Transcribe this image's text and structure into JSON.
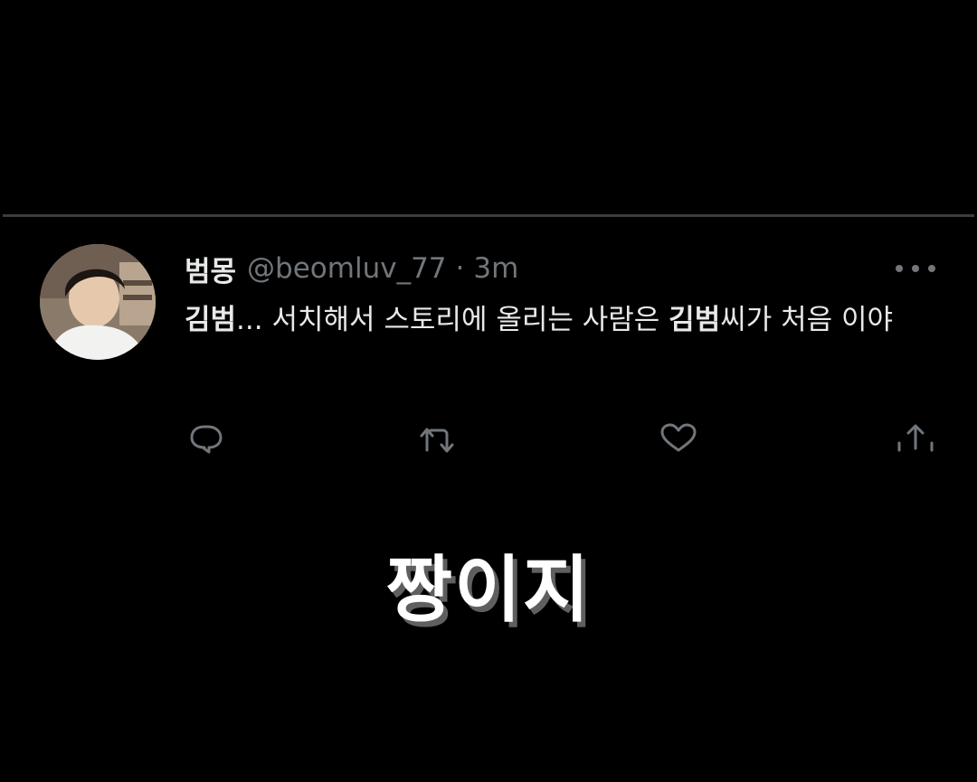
{
  "tweet": {
    "display_name": "범몽",
    "handle": "@beomluv_77",
    "separator": "·",
    "time": "3m",
    "body": {
      "part1_bold": "김범",
      "part2": "... 서치해서 스토리에 올리는 사람은 ",
      "part3_bold": "김범",
      "part4": "씨가 처음 이야"
    },
    "more_icon": "more-dots-icon",
    "actions": [
      "reply-icon",
      "retweet-icon",
      "like-icon",
      "share-icon"
    ]
  },
  "caption": "짱이지",
  "colors": {
    "background": "#000000",
    "text": "#e7e9ea",
    "secondary": "#71767b",
    "divider": "#3a3d40"
  }
}
